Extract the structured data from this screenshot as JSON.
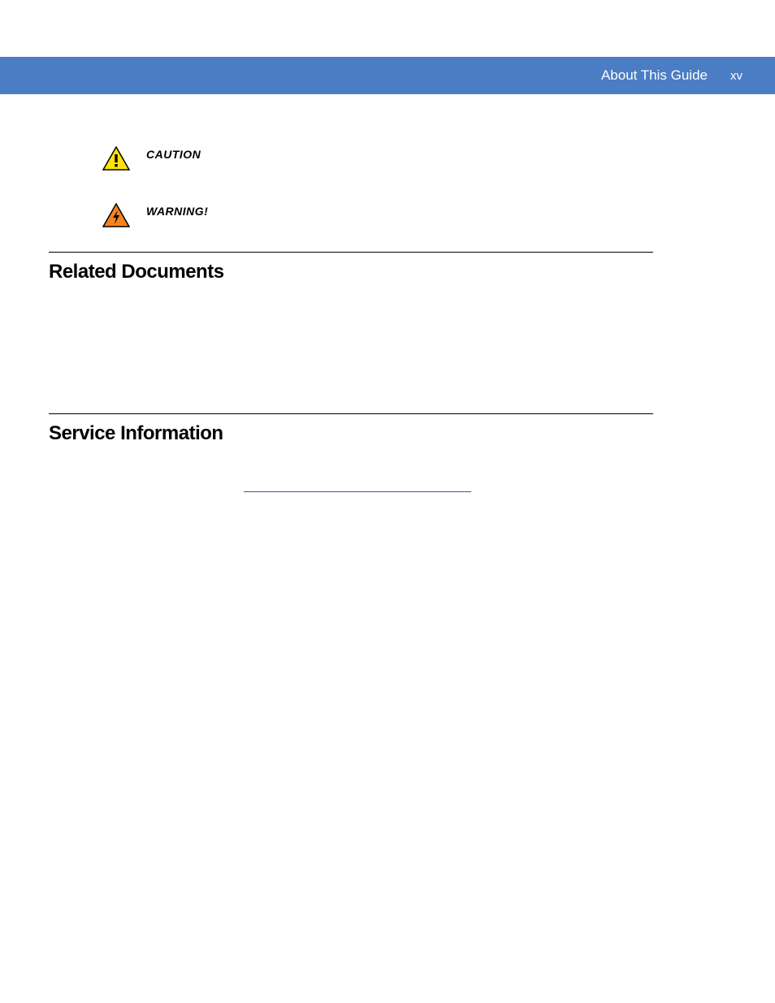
{
  "header": {
    "title": "About This Guide",
    "page_number": "xv"
  },
  "callouts": {
    "caution_label": "CAUTION",
    "warning_label": "WARNING!"
  },
  "sections": {
    "related": {
      "heading": "Related Documents"
    },
    "service": {
      "heading": "Service Information"
    }
  }
}
